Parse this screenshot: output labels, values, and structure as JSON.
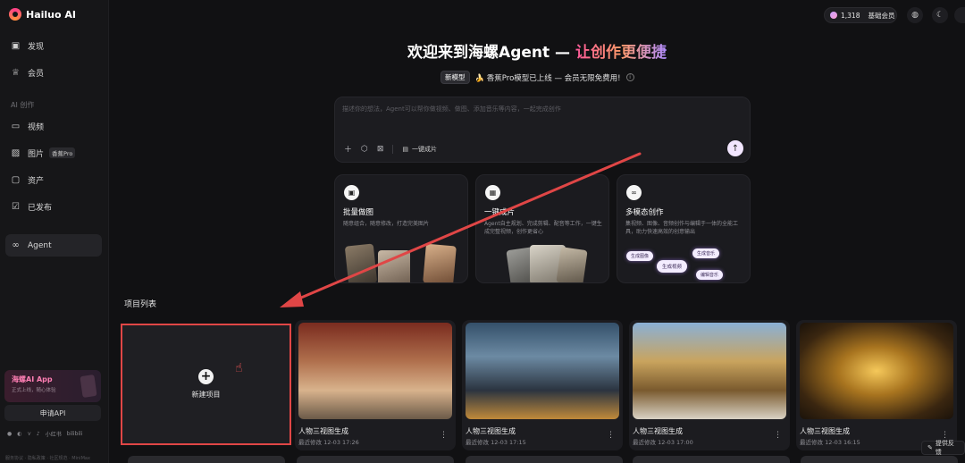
{
  "app": {
    "logo_text": "Hailuo AI"
  },
  "sidebar": {
    "discover": "发现",
    "member": "会员",
    "section_ai": "AI 创作",
    "video": "视频",
    "image": "图片",
    "image_tag": "香蕉Pro",
    "assets": "资产",
    "published": "已发布",
    "agent": "Agent",
    "app_card_title": "海螺AI App",
    "app_card_sub": "正式上线，随心体验",
    "api_button": "申请API",
    "social_labels": [
      "小红书",
      "bilibili"
    ],
    "footer": "服务协议 · 隐私政策 · 社区规范 · MiniMax"
  },
  "topbar": {
    "credits": "1,318",
    "member": "基础会员"
  },
  "hero": {
    "title_main": "欢迎来到海螺Agent — ",
    "title_highlight": "让创作更便捷",
    "new_badge": "新模型",
    "announcement": "🍌 香蕉Pro模型已上线 — 会员无限免费用!"
  },
  "prompt": {
    "placeholder": "描述你的想法，Agent可以帮你做视频、做图、添加音乐等内容，一起完成创作",
    "one_click": "一键成片"
  },
  "features": [
    {
      "title": "批量做图",
      "desc": "随意组合，随意修改，打造完美图片"
    },
    {
      "title": "一键成片",
      "desc": "Agent自主规划、完成剪辑、配音等工作，一键生成完整视频，创作更省心"
    },
    {
      "title": "多模态创作",
      "desc": "集视频、图像、音频创作与编辑于一体的全能工具，助力快速高效的创意输出"
    }
  ],
  "feature_pills": [
    "生成图像",
    "生成视频",
    "生成音乐",
    "编辑音乐"
  ],
  "projects": {
    "section_title": "项目列表",
    "new_project": "新建项目",
    "items": [
      {
        "title": "人物三视图生成",
        "date": "最近修改 12-03 17:26"
      },
      {
        "title": "人物三视图生成",
        "date": "最近修改 12-03 17:15"
      },
      {
        "title": "人物三视图生成",
        "date": "最近修改 12-03 17:00"
      },
      {
        "title": "人物三视图生成",
        "date": "最近修改 12-03 16:15"
      }
    ]
  },
  "feedback": "提供反馈",
  "colors": {
    "accent": "#ff5a9a",
    "annotation": "#e04646",
    "background": "#111113"
  }
}
